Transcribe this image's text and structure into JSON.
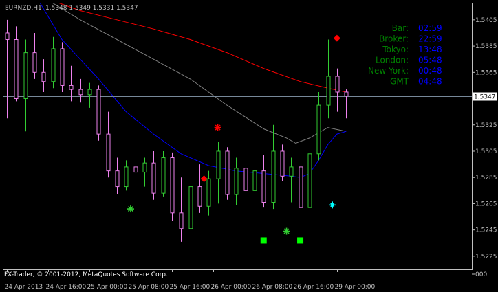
{
  "header": {
    "symbol": "EURNZD,H1",
    "ohlc": "1.5348 1.5349 1.5331 1.5347"
  },
  "colors": {
    "background": "#000000",
    "axis": "#c0c0c0",
    "bull": "#32cd32",
    "bear": "#ee82ee",
    "ma_red": "#ff0000",
    "ma_gray": "#808080",
    "ma_blue": "#0000ff",
    "bid_line": "#778899",
    "clock_label": "#008000",
    "clock_value": "#0000ff",
    "copyright": "#ffffff"
  },
  "price_axis": {
    "labels": [
      "1.5405",
      "1.5385",
      "1.5365",
      "1.5345",
      "1.5325",
      "1.5305",
      "1.5285",
      "1.5265",
      "1.5245",
      "1.5225",
      "000"
    ],
    "current_price": "1.5347"
  },
  "time_axis": {
    "labels": [
      "24 Apr 2013",
      "24 Apr 16:00",
      "25 Apr 00:00",
      "25 Apr 08:00",
      "25 Apr 16:00",
      "26 Apr 00:00",
      "26 Apr 08:00",
      "26 Apr 16:00",
      "29 Apr 00:00"
    ]
  },
  "clock_panel": {
    "rows": [
      {
        "label": "Bar:",
        "value": "02:59"
      },
      {
        "label": "Broker:",
        "value": "22:59"
      },
      {
        "label": "Tokyo:",
        "value": "13:48"
      },
      {
        "label": "London:",
        "value": "05:48"
      },
      {
        "label": "New York:",
        "value": "00:48"
      },
      {
        "label": "GMT",
        "value": "04:48"
      }
    ]
  },
  "copyright": "FX-Trader, © 2001-2012, MetaQuotes Software Corp.",
  "markers": [
    {
      "shape": "diamond",
      "color": "#ff0000",
      "time": 36,
      "price": 1.5391
    },
    {
      "shape": "diamond",
      "color": "#ff0000",
      "time": 21.5,
      "price": 1.5284
    },
    {
      "shape": "asterisk",
      "color": "#ff0000",
      "time": 23,
      "price": 1.5323
    },
    {
      "shape": "asterisk",
      "color": "#32cd32",
      "time": 13.5,
      "price": 1.5261
    },
    {
      "shape": "asterisk",
      "color": "#32cd32",
      "time": 30.5,
      "price": 1.5244
    },
    {
      "shape": "cross",
      "color": "#00ffff",
      "time": 35.5,
      "price": 1.5264
    },
    {
      "shape": "square",
      "color": "#00ff00",
      "time": 28,
      "price": 1.5237
    },
    {
      "shape": "square",
      "color": "#00ff00",
      "time": 32,
      "price": 1.5237
    }
  ],
  "chart_data": {
    "type": "candlestick",
    "title": "EURNZD,H1",
    "ylim": [
      1.5215,
      1.5418
    ],
    "xlim": [
      -0.5,
      37.5
    ],
    "x_tick_positions": [
      0,
      4.5,
      9,
      13.5,
      18,
      22.5,
      27,
      31.5,
      36
    ],
    "y_ticks": [
      1.5405,
      1.5385,
      1.5365,
      1.5345,
      1.5325,
      1.5305,
      1.5285,
      1.5265,
      1.5245,
      1.5225
    ],
    "candles": [
      {
        "o": 1.5395,
        "h": 1.5405,
        "l": 1.533,
        "c": 1.539
      },
      {
        "o": 1.539,
        "h": 1.54,
        "l": 1.5343,
        "c": 1.5345
      },
      {
        "o": 1.5345,
        "h": 1.539,
        "l": 1.532,
        "c": 1.538
      },
      {
        "o": 1.538,
        "h": 1.5395,
        "l": 1.536,
        "c": 1.5365
      },
      {
        "o": 1.5365,
        "h": 1.5375,
        "l": 1.535,
        "c": 1.5358
      },
      {
        "o": 1.5358,
        "h": 1.5392,
        "l": 1.5353,
        "c": 1.5383
      },
      {
        "o": 1.5383,
        "h": 1.5388,
        "l": 1.535,
        "c": 1.5355
      },
      {
        "o": 1.5355,
        "h": 1.537,
        "l": 1.5343,
        "c": 1.5352
      },
      {
        "o": 1.5352,
        "h": 1.536,
        "l": 1.5342,
        "c": 1.5348
      },
      {
        "o": 1.5348,
        "h": 1.5357,
        "l": 1.5338,
        "c": 1.5352
      },
      {
        "o": 1.5352,
        "h": 1.5355,
        "l": 1.5313,
        "c": 1.5318
      },
      {
        "o": 1.5318,
        "h": 1.5335,
        "l": 1.5285,
        "c": 1.529
      },
      {
        "o": 1.529,
        "h": 1.53,
        "l": 1.5272,
        "c": 1.5278
      },
      {
        "o": 1.5278,
        "h": 1.5298,
        "l": 1.5275,
        "c": 1.5293
      },
      {
        "o": 1.5293,
        "h": 1.53,
        "l": 1.5283,
        "c": 1.5289
      },
      {
        "o": 1.5289,
        "h": 1.53,
        "l": 1.5278,
        "c": 1.5296
      },
      {
        "o": 1.5296,
        "h": 1.5305,
        "l": 1.5268,
        "c": 1.5273
      },
      {
        "o": 1.5273,
        "h": 1.5305,
        "l": 1.527,
        "c": 1.53
      },
      {
        "o": 1.53,
        "h": 1.5304,
        "l": 1.5252,
        "c": 1.5258
      },
      {
        "o": 1.5258,
        "h": 1.5285,
        "l": 1.5236,
        "c": 1.5246
      },
      {
        "o": 1.5246,
        "h": 1.5284,
        "l": 1.5242,
        "c": 1.5278
      },
      {
        "o": 1.5278,
        "h": 1.5295,
        "l": 1.5258,
        "c": 1.5263
      },
      {
        "o": 1.5263,
        "h": 1.529,
        "l": 1.5256,
        "c": 1.5284
      },
      {
        "o": 1.5284,
        "h": 1.5312,
        "l": 1.5265,
        "c": 1.5305
      },
      {
        "o": 1.5305,
        "h": 1.5308,
        "l": 1.5268,
        "c": 1.5272
      },
      {
        "o": 1.5272,
        "h": 1.53,
        "l": 1.5264,
        "c": 1.5292
      },
      {
        "o": 1.5292,
        "h": 1.5297,
        "l": 1.5268,
        "c": 1.5275
      },
      {
        "o": 1.5275,
        "h": 1.53,
        "l": 1.5265,
        "c": 1.529
      },
      {
        "o": 1.529,
        "h": 1.5302,
        "l": 1.5262,
        "c": 1.5266
      },
      {
        "o": 1.5266,
        "h": 1.5325,
        "l": 1.5261,
        "c": 1.5305
      },
      {
        "o": 1.5305,
        "h": 1.531,
        "l": 1.5282,
        "c": 1.5286
      },
      {
        "o": 1.5286,
        "h": 1.53,
        "l": 1.5266,
        "c": 1.5293
      },
      {
        "o": 1.5293,
        "h": 1.5298,
        "l": 1.5254,
        "c": 1.5262
      },
      {
        "o": 1.5262,
        "h": 1.5312,
        "l": 1.5258,
        "c": 1.5303
      },
      {
        "o": 1.5303,
        "h": 1.535,
        "l": 1.5298,
        "c": 1.534
      },
      {
        "o": 1.534,
        "h": 1.539,
        "l": 1.533,
        "c": 1.5362
      },
      {
        "o": 1.5362,
        "h": 1.5368,
        "l": 1.5335,
        "c": 1.535
      },
      {
        "o": 1.535,
        "h": 1.5352,
        "l": 1.533,
        "c": 1.5347
      }
    ],
    "ma_red": [
      [
        0,
        1.5432
      ],
      [
        4,
        1.5422
      ],
      [
        8,
        1.5412
      ],
      [
        12,
        1.5405
      ],
      [
        16,
        1.5398
      ],
      [
        20,
        1.539
      ],
      [
        24,
        1.538
      ],
      [
        28,
        1.5368
      ],
      [
        32,
        1.5358
      ],
      [
        35,
        1.5353
      ],
      [
        37,
        1.535
      ]
    ],
    "ma_gray": [
      [
        4,
        1.5422
      ],
      [
        8,
        1.5405
      ],
      [
        12,
        1.539
      ],
      [
        16,
        1.5375
      ],
      [
        20,
        1.536
      ],
      [
        24,
        1.534
      ],
      [
        28,
        1.5322
      ],
      [
        30.5,
        1.5315
      ],
      [
        31.5,
        1.5311
      ],
      [
        33,
        1.5315
      ],
      [
        35,
        1.5323
      ],
      [
        37,
        1.532
      ]
    ],
    "ma_blue": [
      [
        3,
        1.5425
      ],
      [
        6,
        1.539
      ],
      [
        10,
        1.536
      ],
      [
        13,
        1.5335
      ],
      [
        16,
        1.5318
      ],
      [
        19,
        1.5303
      ],
      [
        22,
        1.5294
      ],
      [
        25,
        1.529
      ],
      [
        28,
        1.5288
      ],
      [
        31,
        1.5286
      ],
      [
        32,
        1.5285
      ],
      [
        33,
        1.5288
      ],
      [
        34,
        1.5298
      ],
      [
        35,
        1.531
      ],
      [
        36,
        1.5318
      ],
      [
        37,
        1.532
      ]
    ]
  }
}
